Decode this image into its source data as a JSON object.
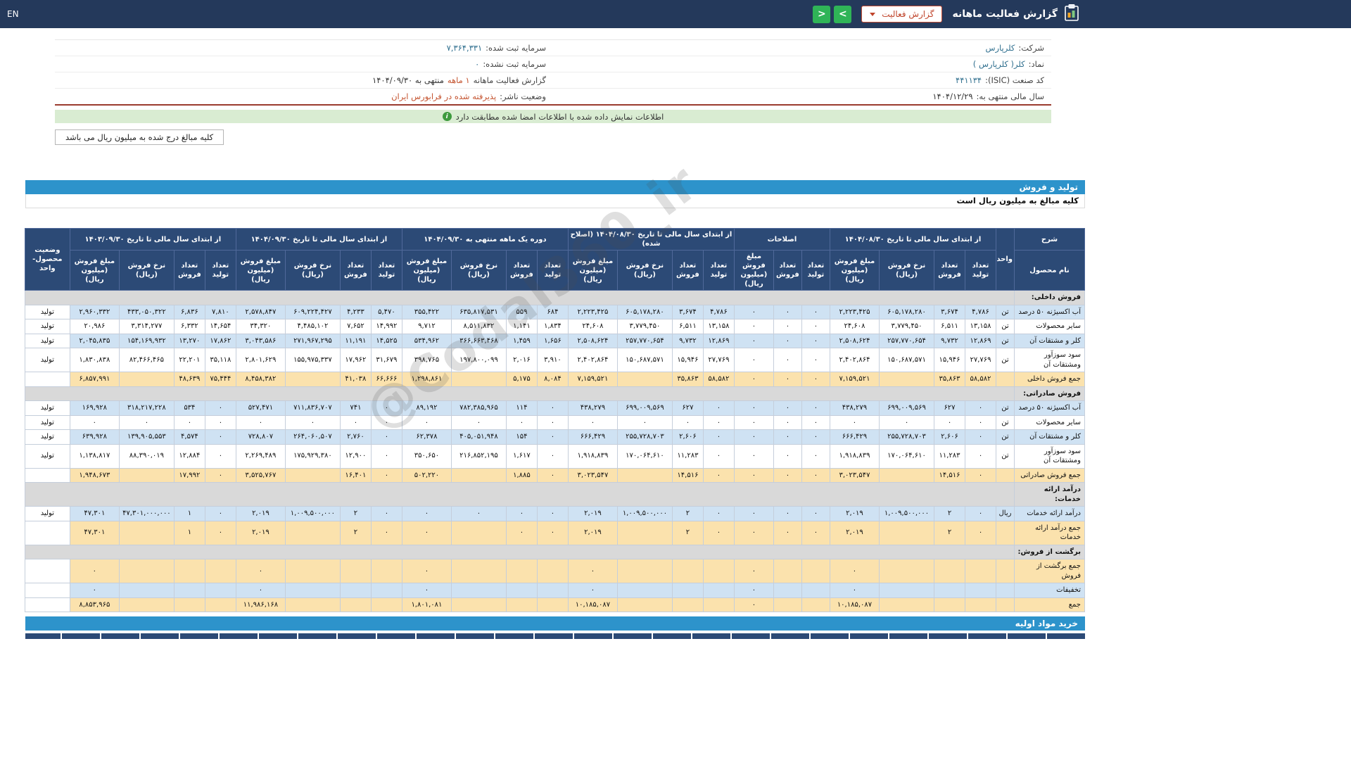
{
  "topbar": {
    "title": "گزارش فعالیت ماهانه",
    "dropdown": "گزارش فعالیت",
    "next": ">",
    "prev": "<",
    "lang": "EN"
  },
  "info": {
    "r0": {
      "label": "شرکت:",
      "value": "کلرپارس"
    },
    "r1": {
      "label": "نماد:",
      "value": "کلر( کلرپارس )"
    },
    "r2": {
      "label": "کد صنعت (ISIC):",
      "value": "۴۴۱۱۳۴"
    },
    "r3": {
      "label": "سال مالی منتهی به:",
      "value": "۱۴۰۴/۱۲/۲۹"
    },
    "l0": {
      "label": "سرمایه ثبت شده:",
      "value": "۷,۳۶۴,۳۳۱"
    },
    "l1": {
      "label": "سرمایه ثبت نشده:",
      "value": "۰"
    },
    "l2": {
      "label": "گزارش فعالیت ماهانه",
      "value": "۱ ماهه",
      "suffix": "منتهی به ۱۴۰۴/۰۹/۳۰"
    },
    "l3": {
      "label": "وضعیت ناشر:",
      "value": "پذیرفته شده در فرابورس ایران"
    }
  },
  "notice": {
    "text": "اطلاعات نمایش داده شده با اطلاعات امضا شده مطابقت دارد"
  },
  "unit_note": "کلیه مبالغ درج شده به میلیون ریال می باشد",
  "section": {
    "title": "تولید و فروش",
    "subtitle": "کلیه مبالغ به میلیون ریال است",
    "footer": "خرید مواد اولیه"
  },
  "watermark": "@Codal360_ir",
  "table": {
    "corner": {
      "desc": "شرح",
      "product": "نام محصول",
      "unit": "واحد",
      "status": "وضعیت محصول-واحد"
    },
    "col_labels": {
      "qty_prod": "تعداد تولید",
      "qty_sold": "تعداد فروش",
      "rate": "نرخ فروش (ریال)",
      "amount": "مبلغ فروش (میلیون ریال)"
    },
    "groups": [
      {
        "label": "از ابتدای سال مالی تا تاریخ ۱۴۰۴/۰۸/۳۰",
        "cols": [
          "qty_prod",
          "qty_sold",
          "rate",
          "amount"
        ]
      },
      {
        "label": "اصلاحات",
        "cols": [
          "qty_prod",
          "qty_sold",
          "amount"
        ]
      },
      {
        "label": "از ابتدای سال مالی تا تاریخ ۱۴۰۴/۰۸/۳۰ (اصلاح شده)",
        "cols": [
          "qty_prod",
          "qty_sold",
          "rate",
          "amount"
        ]
      },
      {
        "label": "دوره یک ماهه منتهی به ۱۴۰۴/۰۹/۳۰",
        "cols": [
          "qty_prod",
          "qty_sold",
          "rate",
          "amount"
        ]
      },
      {
        "label": "از ابتدای سال مالی تا تاریخ ۱۴۰۴/۰۹/۳۰",
        "cols": [
          "qty_prod",
          "qty_sold",
          "rate",
          "amount"
        ]
      },
      {
        "label": "از ابتدای سال مالی تا تاریخ ۱۴۰۳/۰۹/۳۰",
        "cols": [
          "qty_prod",
          "qty_sold",
          "rate",
          "amount"
        ]
      }
    ],
    "rows": [
      {
        "type": "section",
        "label": "فروش داخلی:"
      },
      {
        "type": "data",
        "label": "آب اکسیژنه ۵۰ درصد",
        "unit": "تن",
        "status": "تولید",
        "values": [
          "۴,۷۸۶",
          "۳,۶۷۴",
          "۶۰۵,۱۷۸,۲۸۰",
          "۲,۲۲۳,۴۲۵",
          "۰",
          "۰",
          "۰",
          "۴,۷۸۶",
          "۳,۶۷۴",
          "۶۰۵,۱۷۸,۲۸۰",
          "۲,۲۲۳,۴۲۵",
          "۶۸۴",
          "۵۵۹",
          "۶۳۵,۸۱۷,۵۳۱",
          "۳۵۵,۴۲۲",
          "۵,۴۷۰",
          "۴,۲۳۳",
          "۶۰۹,۲۲۴,۴۲۷",
          "۲,۵۷۸,۸۴۷",
          "۷,۸۱۰",
          "۶,۸۳۶",
          "۴۳۳,۰۵۰,۳۲۲",
          "۲,۹۶۰,۳۳۲"
        ]
      },
      {
        "type": "data",
        "label": "سایر محصولات",
        "unit": "تن",
        "status": "تولید",
        "values": [
          "۱۳,۱۵۸",
          "۶,۵۱۱",
          "۳,۷۷۹,۴۵۰",
          "۲۴,۶۰۸",
          "۰",
          "۰",
          "۰",
          "۱۳,۱۵۸",
          "۶,۵۱۱",
          "۳,۷۷۹,۴۵۰",
          "۲۴,۶۰۸",
          "۱,۸۳۴",
          "۱,۱۴۱",
          "۸,۵۱۱,۸۳۲",
          "۹,۷۱۲",
          "۱۴,۹۹۲",
          "۷,۶۵۲",
          "۴,۴۸۵,۱۰۲",
          "۳۴,۳۲۰",
          "۱۴,۶۵۴",
          "۶,۳۳۲",
          "۳,۳۱۴,۲۷۷",
          "۲۰,۹۸۶"
        ]
      },
      {
        "type": "data",
        "label": "کلر و مشتقات آن",
        "unit": "تن",
        "status": "تولید",
        "values": [
          "۱۲,۸۶۹",
          "۹,۷۳۲",
          "۲۵۷,۷۷۰,۶۵۴",
          "۲,۵۰۸,۶۲۴",
          "۰",
          "۰",
          "۰",
          "۱۲,۸۶۹",
          "۹,۷۳۲",
          "۲۵۷,۷۷۰,۶۵۴",
          "۲,۵۰۸,۶۲۴",
          "۱,۶۵۶",
          "۱,۴۵۹",
          "۳۶۶,۶۶۳,۴۶۸",
          "۵۳۴,۹۶۲",
          "۱۴,۵۲۵",
          "۱۱,۱۹۱",
          "۲۷۱,۹۶۷,۲۹۵",
          "۳,۰۴۳,۵۸۶",
          "۱۷,۸۶۲",
          "۱۳,۲۷۰",
          "۱۵۴,۱۶۹,۹۳۲",
          "۲,۰۴۵,۸۳۵"
        ]
      },
      {
        "type": "data",
        "label": "سود سوزآور ومشتقات آن",
        "unit": "تن",
        "status": "تولید",
        "values": [
          "۲۷,۷۶۹",
          "۱۵,۹۴۶",
          "۱۵۰,۶۸۷,۵۷۱",
          "۲,۴۰۲,۸۶۴",
          "۰",
          "۰",
          "۰",
          "۲۷,۷۶۹",
          "۱۵,۹۴۶",
          "۱۵۰,۶۸۷,۵۷۱",
          "۲,۴۰۲,۸۶۴",
          "۳,۹۱۰",
          "۲,۰۱۶",
          "۱۹۷,۸۰۰,۰۹۹",
          "۳۹۸,۷۶۵",
          "۳۱,۶۷۹",
          "۱۷,۹۶۲",
          "۱۵۵,۹۷۵,۳۳۷",
          "۲,۸۰۱,۶۲۹",
          "۳۵,۱۱۸",
          "۲۲,۲۰۱",
          "۸۲,۴۶۶,۴۶۵",
          "۱,۸۳۰,۸۳۸"
        ]
      },
      {
        "type": "total",
        "label": "جمع فروش داخلی",
        "values": [
          "۵۸,۵۸۲",
          "۳۵,۸۶۳",
          "",
          "۷,۱۵۹,۵۲۱",
          "۰",
          "۰",
          "۰",
          "۵۸,۵۸۲",
          "۳۵,۸۶۳",
          "",
          "۷,۱۵۹,۵۲۱",
          "۸,۰۸۴",
          "۵,۱۷۵",
          "",
          "۱,۲۹۸,۸۶۱",
          "۶۶,۶۶۶",
          "۴۱,۰۳۸",
          "",
          "۸,۴۵۸,۳۸۲",
          "۷۵,۴۴۴",
          "۴۸,۶۳۹",
          "",
          "۶,۸۵۷,۹۹۱"
        ]
      },
      {
        "type": "section",
        "label": "فروش صادراتی:"
      },
      {
        "type": "data",
        "label": "آب اکسیژنه ۵۰ درصد",
        "unit": "تن",
        "status": "تولید",
        "values": [
          "۰",
          "۶۲۷",
          "۶۹۹,۰۰۹,۵۶۹",
          "۴۳۸,۲۷۹",
          "۰",
          "۰",
          "۰",
          "۰",
          "۶۲۷",
          "۶۹۹,۰۰۹,۵۶۹",
          "۴۳۸,۲۷۹",
          "۰",
          "۱۱۴",
          "۷۸۲,۳۸۵,۹۶۵",
          "۸۹,۱۹۲",
          "۰",
          "۷۴۱",
          "۷۱۱,۸۳۶,۷۰۷",
          "۵۲۷,۴۷۱",
          "۰",
          "۵۳۴",
          "۳۱۸,۲۱۷,۲۲۸",
          "۱۶۹,۹۲۸"
        ]
      },
      {
        "type": "data",
        "label": "سایر محصولات",
        "unit": "تن",
        "status": "تولید",
        "values": [
          "۰",
          "۰",
          "۰",
          "۰",
          "۰",
          "۰",
          "۰",
          "۰",
          "۰",
          "۰",
          "۰",
          "۰",
          "۰",
          "۰",
          "۰",
          "۰",
          "۰",
          "۰",
          "۰",
          "۰",
          "۰",
          "۰",
          "۰"
        ]
      },
      {
        "type": "data",
        "label": "کلر و مشتقات آن",
        "unit": "تن",
        "status": "تولید",
        "values": [
          "۰",
          "۲,۶۰۶",
          "۲۵۵,۷۲۸,۷۰۳",
          "۶۶۶,۴۲۹",
          "۰",
          "۰",
          "۰",
          "۰",
          "۲,۶۰۶",
          "۲۵۵,۷۲۸,۷۰۳",
          "۶۶۶,۴۲۹",
          "۰",
          "۱۵۴",
          "۴۰۵,۰۵۱,۹۴۸",
          "۶۲,۳۷۸",
          "۰",
          "۲,۷۶۰",
          "۲۶۴,۰۶۰,۵۰۷",
          "۷۲۸,۸۰۷",
          "۰",
          "۴,۵۷۴",
          "۱۳۹,۹۰۵,۵۵۳",
          "۶۳۹,۹۲۸"
        ]
      },
      {
        "type": "data",
        "label": "سود سوزآور ومشتقات آن",
        "unit": "تن",
        "status": "تولید",
        "values": [
          "۰",
          "۱۱,۲۸۳",
          "۱۷۰,۰۶۴,۶۱۰",
          "۱,۹۱۸,۸۳۹",
          "۰",
          "۰",
          "۰",
          "۰",
          "۱۱,۲۸۳",
          "۱۷۰,۰۶۴,۶۱۰",
          "۱,۹۱۸,۸۳۹",
          "۰",
          "۱,۶۱۷",
          "۲۱۶,۸۵۲,۱۹۵",
          "۳۵۰,۶۵۰",
          "۰",
          "۱۲,۹۰۰",
          "۱۷۵,۹۲۹,۳۸۰",
          "۲,۲۶۹,۴۸۹",
          "۰",
          "۱۲,۸۸۴",
          "۸۸,۳۹۰,۰۱۹",
          "۱,۱۳۸,۸۱۷"
        ]
      },
      {
        "type": "total",
        "label": "جمع فروش صادراتی",
        "values": [
          "۰",
          "۱۴,۵۱۶",
          "",
          "۳,۰۲۳,۵۴۷",
          "۰",
          "۰",
          "۰",
          "۰",
          "۱۴,۵۱۶",
          "",
          "۳,۰۲۳,۵۴۷",
          "۰",
          "۱,۸۸۵",
          "",
          "۵۰۲,۲۲۰",
          "۰",
          "۱۶,۴۰۱",
          "",
          "۳,۵۲۵,۷۶۷",
          "۰",
          "۱۷,۹۹۲",
          "",
          "۱,۹۴۸,۶۷۳"
        ]
      },
      {
        "type": "section",
        "label": "درآمد ارائه خدمات:"
      },
      {
        "type": "data",
        "label": "درآمد ارائه خدمات",
        "unit": "ریال",
        "status": "تولید",
        "values": [
          "۰",
          "۲",
          "۱,۰۰۹,۵۰۰,۰۰۰",
          "۲,۰۱۹",
          "۰",
          "۰",
          "۰",
          "۰",
          "۲",
          "۱,۰۰۹,۵۰۰,۰۰۰",
          "۲,۰۱۹",
          "۰",
          "۰",
          "۰",
          "۰",
          "۰",
          "۲",
          "۱,۰۰۹,۵۰۰,۰۰۰",
          "۲,۰۱۹",
          "۰",
          "۱",
          "۴۷,۳۰۱,۰۰۰,۰۰۰",
          "۴۷,۳۰۱"
        ]
      },
      {
        "type": "total",
        "label": "جمع درآمد ارائه خدمات",
        "values": [
          "۰",
          "۲",
          "",
          "۲,۰۱۹",
          "۰",
          "۰",
          "۰",
          "۰",
          "۲",
          "",
          "۲,۰۱۹",
          "۰",
          "۰",
          "",
          "۰",
          "۰",
          "۲",
          "",
          "۲,۰۱۹",
          "۰",
          "۱",
          "",
          "۴۷,۳۰۱"
        ]
      },
      {
        "type": "section",
        "label": "برگشت از فروش:"
      },
      {
        "type": "total",
        "label": "جمع برگشت از فروش",
        "values": [
          "",
          "",
          "",
          "۰",
          "",
          "",
          "۰",
          "",
          "",
          "",
          "۰",
          "",
          "",
          "",
          "۰",
          "",
          "",
          "",
          "۰",
          "",
          "",
          "",
          "۰"
        ]
      },
      {
        "type": "data",
        "label": "تخفیفات",
        "unit": "",
        "status": "",
        "values": [
          "",
          "",
          "",
          "۰",
          "",
          "",
          "۰",
          "",
          "",
          "",
          "۰",
          "",
          "",
          "",
          "۰",
          "",
          "",
          "",
          "۰",
          "",
          "",
          "",
          "۰"
        ]
      },
      {
        "type": "total",
        "label": "جمع",
        "values": [
          "",
          "",
          "",
          "۱۰,۱۸۵,۰۸۷",
          "",
          "",
          "۰",
          "",
          "",
          "",
          "۱۰,۱۸۵,۰۸۷",
          "",
          "",
          "",
          "۱,۸۰۱,۰۸۱",
          "",
          "",
          "",
          "۱۱,۹۸۶,۱۶۸",
          "",
          "",
          "",
          "۸,۸۵۳,۹۶۵"
        ]
      }
    ]
  }
}
